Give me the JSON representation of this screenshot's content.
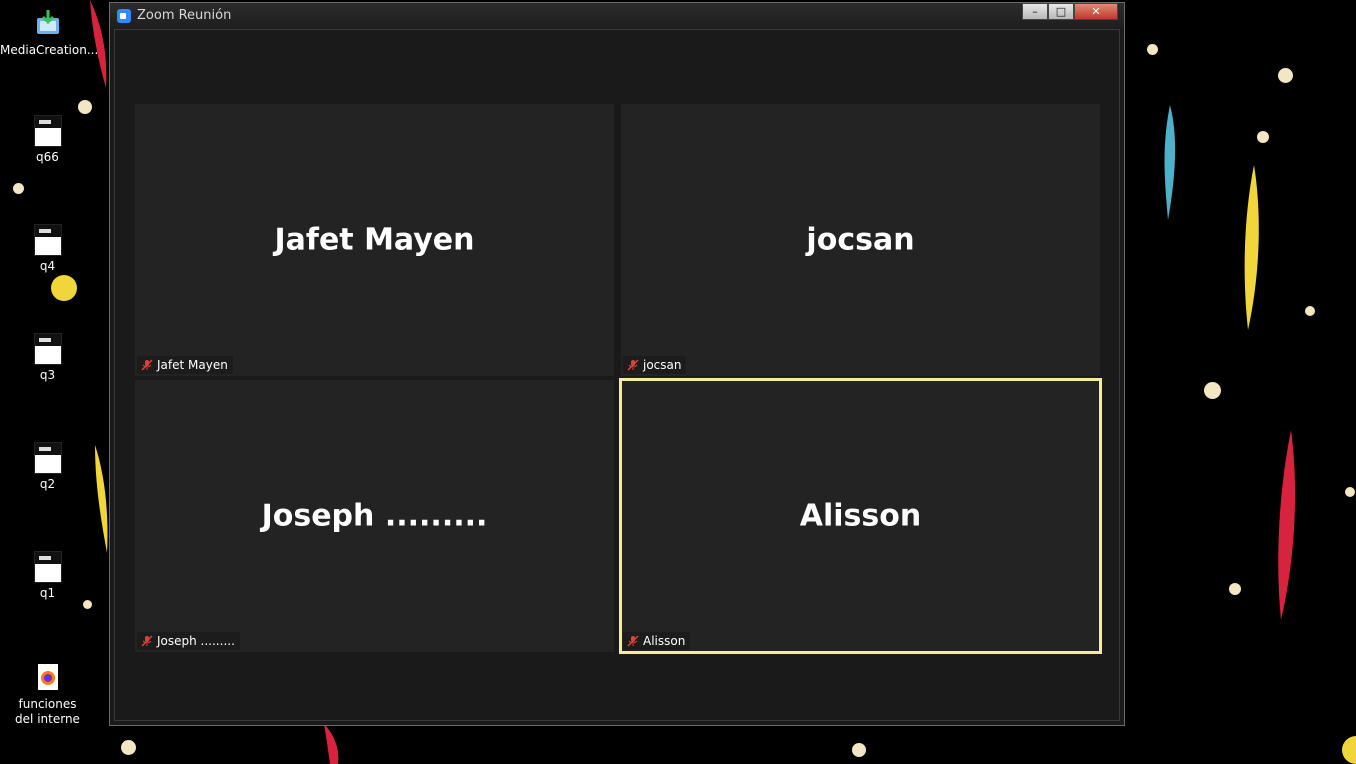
{
  "window": {
    "title": "Zoom Reunión",
    "minimize": "–",
    "maximize": "□",
    "close": "✕"
  },
  "desktop_icons": [
    {
      "label": "MediaCreation..."
    },
    {
      "label": "q66"
    },
    {
      "label": "q4"
    },
    {
      "label": "q3"
    },
    {
      "label": "q2"
    },
    {
      "label": "q1"
    },
    {
      "label": "funciones del interne"
    }
  ],
  "participants": [
    {
      "name": "Jafet Mayen",
      "label": "Jafet Mayen",
      "muted": true,
      "active": false
    },
    {
      "name": "jocsan",
      "label": "jocsan",
      "muted": true,
      "active": false
    },
    {
      "name": "Joseph .........",
      "label": "Joseph .........",
      "muted": true,
      "active": false
    },
    {
      "name": "Alisson",
      "label": "Alisson",
      "muted": true,
      "active": true
    }
  ],
  "colors": {
    "active_speaker_border": "#f3ee9a",
    "muted_icon": "#e0413a"
  },
  "icons": {
    "muted": "mic-muted-icon"
  }
}
